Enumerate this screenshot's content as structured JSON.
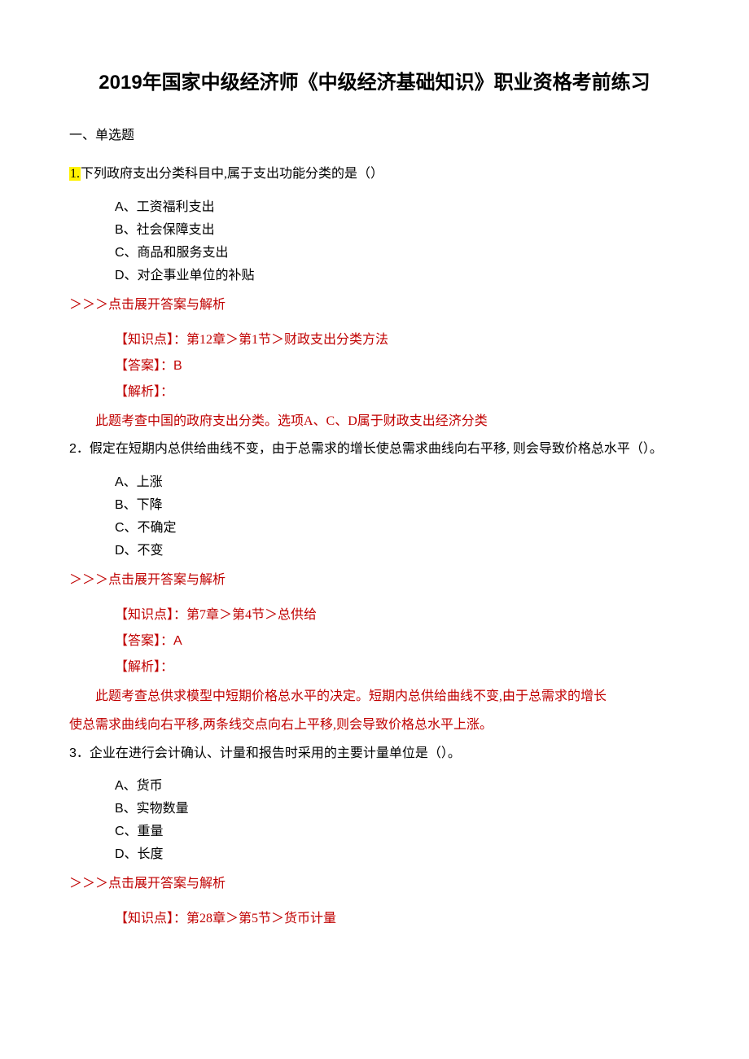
{
  "title": "2019年国家中级经济师《中级经济基础知识》职业资格考前练习",
  "section_heading": "一、单选题",
  "expand_label": "＞＞＞点击展开答案与解析",
  "kp_label": "【知识点】：",
  "ans_label": "【答案】：",
  "exp_label": "【解析】：",
  "q1": {
    "num_hl": "1.",
    "text": "下列政府支出分类科目中,属于支出功能分类的是（）",
    "optA": "A、工资福利支出",
    "optB": "B、社会保障支出",
    "optC": "C、商品和服务支出",
    "optD": "D、对企事业单位的补贴",
    "kp": "第12章＞第1节＞财政支出分类方法",
    "ans": "B",
    "explain": "此题考查中国的政府支出分类。选项A、C、D属于财政支出经济分类"
  },
  "q2": {
    "num": "2",
    "text": "．假定在短期内总供给曲线不变，由于总需求的增长使总需求曲线向右平移,  则会导致价格总水平（）。",
    "optA": "A、上涨",
    "optB": "B、下降",
    "optC": "C、不确定",
    "optD": "D、不变",
    "kp": "第7章＞第4节＞总供给",
    "ans": "A",
    "explain_l1": "此题考查总供求模型中短期价格总水平的决定。短期内总供给曲线不变,由于总需求的增长",
    "explain_l2": "使总需求曲线向右平移,两条线交点向右上平移,则会导致价格总水平上涨。"
  },
  "q3": {
    "num": "3",
    "text": "．企业在进行会计确认、计量和报告时采用的主要计量单位是（）。",
    "optA": "A、货币",
    "optB": "B、实物数量",
    "optC": "C、重量",
    "optD": "D、长度",
    "kp": "第28章＞第5节＞货币计量"
  }
}
